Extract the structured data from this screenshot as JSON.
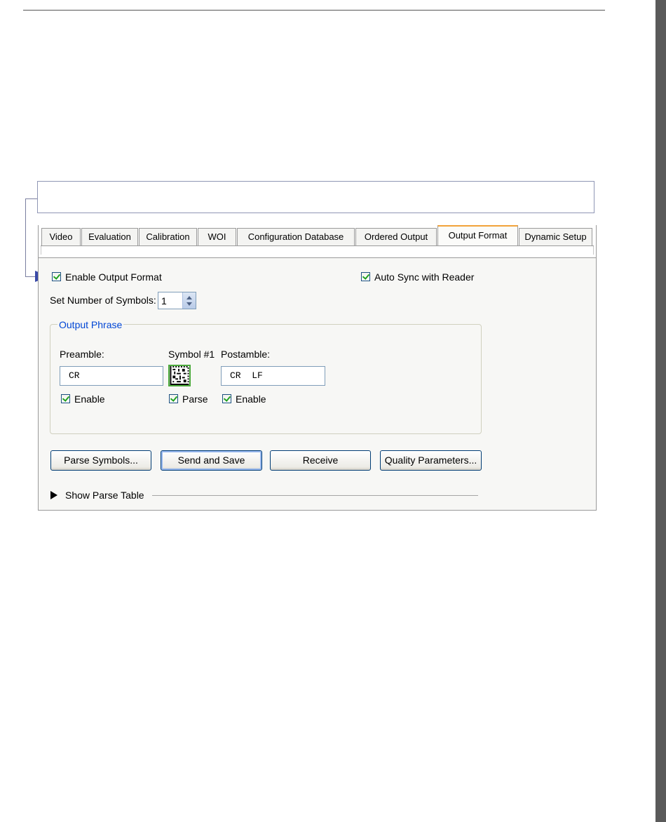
{
  "tabs": [
    {
      "label": "Video",
      "active": false
    },
    {
      "label": "Evaluation",
      "active": false
    },
    {
      "label": "Calibration",
      "active": false
    },
    {
      "label": "WOI",
      "active": false
    },
    {
      "label": "Configuration Database",
      "active": false
    },
    {
      "label": "Ordered Output",
      "active": false
    },
    {
      "label": "Output Format",
      "active": true
    },
    {
      "label": "Dynamic Setup",
      "active": false
    }
  ],
  "options": {
    "enable_output_format": {
      "label": "Enable Output Format",
      "checked": true
    },
    "auto_sync": {
      "label": "Auto Sync with Reader",
      "checked": true
    },
    "num_symbols": {
      "label": "Set Number of Symbols:",
      "value": "1"
    }
  },
  "output_phrase": {
    "legend": "Output Phrase",
    "preamble": {
      "label": "Preamble:",
      "value": "CR",
      "enable_label": "Enable",
      "enabled": true
    },
    "symbol": {
      "label": "Symbol #1",
      "parse_label": "Parse",
      "parse": true
    },
    "postamble": {
      "label": "Postamble:",
      "value": "CR  LF",
      "enable_label": "Enable",
      "enabled": true
    }
  },
  "buttons": {
    "parse_symbols": "Parse Symbols...",
    "send_and_save": "Send and Save",
    "receive": "Receive",
    "quality_parameters": "Quality Parameters..."
  },
  "parse_table": {
    "label": "Show Parse Table"
  },
  "colors": {
    "accent_tab": "#f2a23a",
    "check": "#21a121",
    "legend": "#0046d5",
    "callout_arrow": "#3a4aa8"
  }
}
